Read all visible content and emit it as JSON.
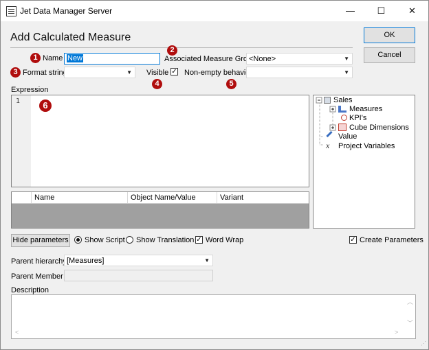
{
  "window": {
    "title": "Jet Data Manager Server",
    "controls": {
      "minimize": "—",
      "maximize": "☐",
      "close": "✕"
    }
  },
  "dialog": {
    "heading": "Add Calculated Measure",
    "ok_label": "OK",
    "cancel_label": "Cancel"
  },
  "form": {
    "name_label": "Name",
    "name_value": "New",
    "assoc_group_label": "Associated Measure Group",
    "assoc_group_value": "<None>",
    "format_string_label": "Format string",
    "format_string_value": "",
    "visible_label": "Visible",
    "visible_checked": true,
    "non_empty_label": "Non-empty behavior",
    "non_empty_value": ""
  },
  "expression": {
    "label": "Expression",
    "line_number": "1"
  },
  "tree": {
    "root": "Sales",
    "items": [
      "Measures",
      "KPI's",
      "Cube Dimensions"
    ],
    "extra": [
      "Value",
      "Project Variables"
    ]
  },
  "params_table": {
    "columns": [
      "Name",
      "Object Name/Value",
      "Variant"
    ]
  },
  "options": {
    "hide_parameters": "Hide parameters",
    "show_script": "Show Script",
    "show_translation": "Show Translation",
    "word_wrap": "Word Wrap",
    "create_parameters": "Create Parameters"
  },
  "parent": {
    "hierarchy_label": "Parent hierarchy",
    "hierarchy_value": "[Measures]",
    "member_label": "Parent Member",
    "member_value": ""
  },
  "description": {
    "label": "Description"
  },
  "badges": [
    "1",
    "2",
    "3",
    "4",
    "5",
    "6"
  ],
  "colors": {
    "badge": "#b00d0d",
    "accent": "#0078d7",
    "selection": "#0078d7"
  }
}
